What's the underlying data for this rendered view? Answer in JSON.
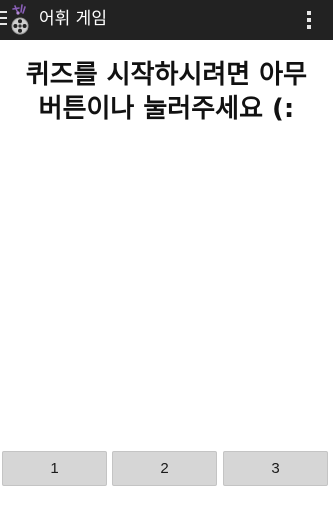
{
  "app": {
    "title": "어휘 게임",
    "icon": "film-reel-app-icon"
  },
  "action_bar": {
    "menu_icon": "hamburger-menu-icon",
    "overflow_icon": "overflow-menu-icon",
    "background": "#222222"
  },
  "quiz": {
    "prompt_line1": "퀴즈를 시작하시려면 아무",
    "prompt_line2": "버튼이나 눌러주세요 (:"
  },
  "answers": [
    {
      "label": "1"
    },
    {
      "label": "2"
    },
    {
      "label": "3"
    }
  ]
}
